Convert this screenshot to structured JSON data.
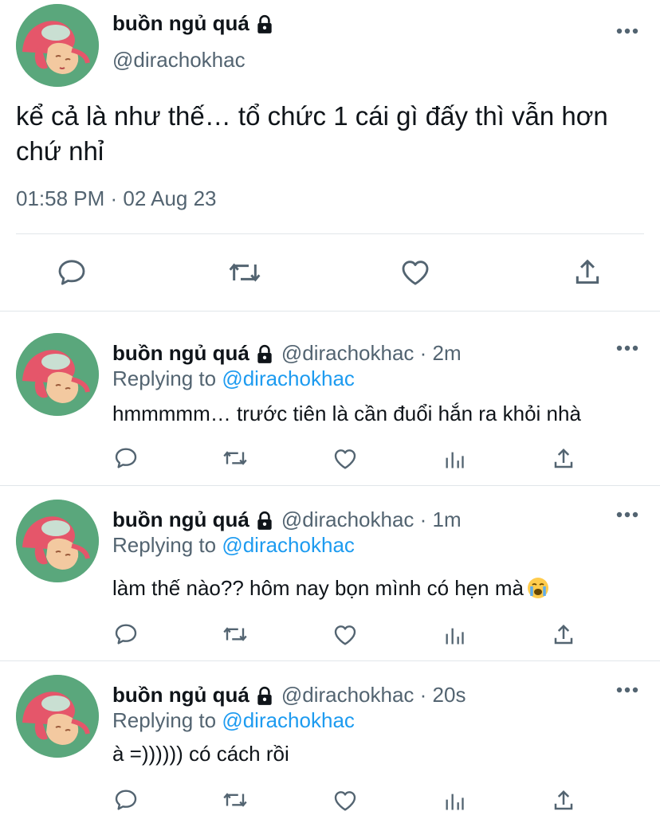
{
  "main_tweet": {
    "display_name": "buồn ngủ quá",
    "handle": "@dirachokhac",
    "text": "kể cả là như thế… tổ chức 1 cái gì đấy thì vẫn hơn chứ nhỉ",
    "timestamp": "01:58 PM · 02 Aug 23",
    "actions": [
      "reply-icon",
      "retweet-icon",
      "like-icon",
      "share-icon"
    ]
  },
  "replies": [
    {
      "display_name": "buồn ngủ quá",
      "handle": "@dirachokhac · 2m",
      "replying_prefix": "Replying to ",
      "replying_to": "@dirachokhac",
      "text": "hmmmmm… trước tiên là cần đuổi hắn ra khỏi nhà"
    },
    {
      "display_name": "buồn ngủ quá",
      "handle": "@dirachokhac · 1m",
      "replying_prefix": "Replying to ",
      "replying_to": "@dirachokhac",
      "text": "làm thế nào?? hôm nay bọn mình có hẹn mà",
      "emoji": "crying-face-emoji"
    },
    {
      "display_name": "buồn ngủ quá",
      "handle": "@dirachokhac · 20s",
      "replying_prefix": "Replying to ",
      "replying_to": "@dirachokhac",
      "text": "à =)))))) có cách rồi"
    }
  ],
  "colors": {
    "text": "#0f1419",
    "secondary": "#536471",
    "link": "#1d9bf0",
    "divider": "#e1e6ea",
    "avatar_bg": "#5aa77c"
  }
}
